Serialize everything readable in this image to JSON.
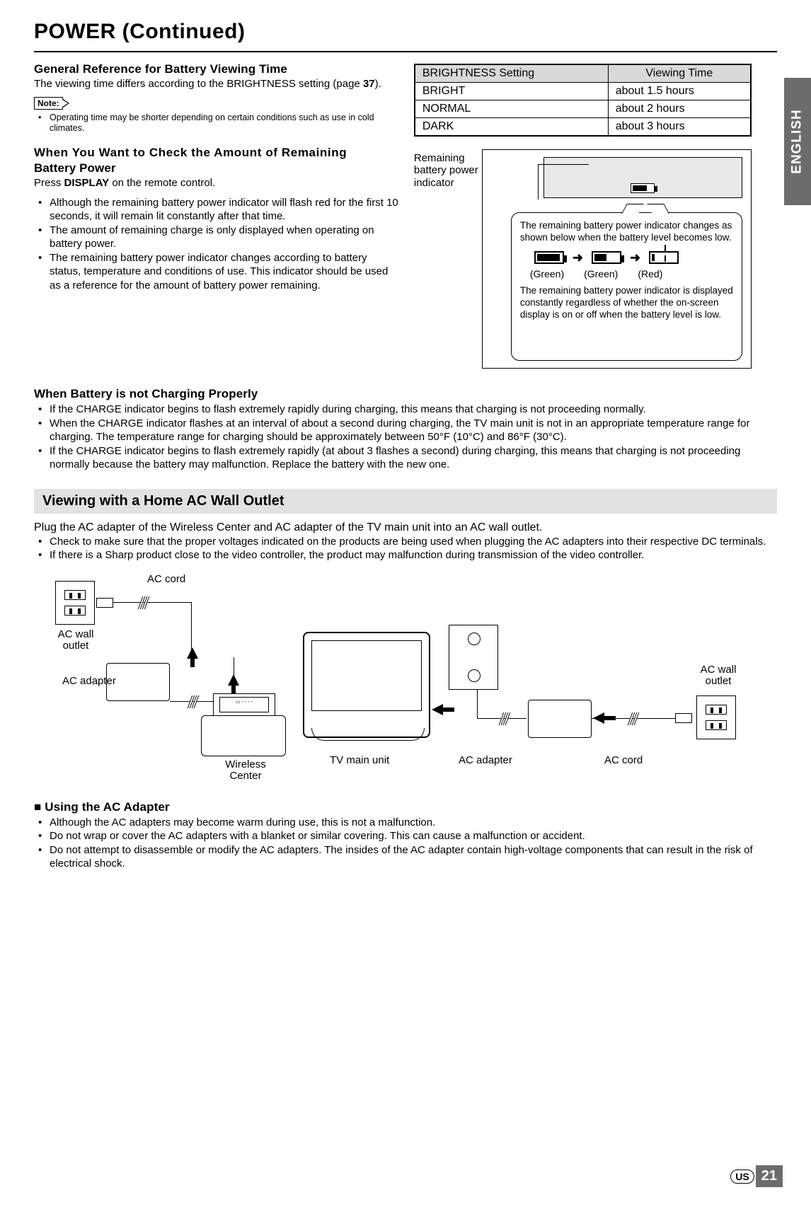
{
  "page_title": "POWER (Continued)",
  "side_tab": "ENGLISH",
  "footer_region": "US",
  "page_number": "21",
  "section1": {
    "heading": "General Reference for Battery Viewing Time",
    "body": "The viewing time differs according to the BRIGHTNESS setting (page ",
    "page_ref": "37",
    "body_end": ").",
    "note_label": "Note:",
    "note_item": "Operating time may be shorter depending on certain conditions such as use in cold climates."
  },
  "brightness_table": {
    "head_setting": "BRIGHTNESS Setting",
    "head_time": "Viewing Time",
    "rows": [
      {
        "setting": "BRIGHT",
        "time": "about 1.5 hours"
      },
      {
        "setting": "NORMAL",
        "time": "about 2 hours"
      },
      {
        "setting": "DARK",
        "time": "about 3 hours"
      }
    ]
  },
  "section2": {
    "heading_line1": "When You Want to Check the Amount of Remaining",
    "heading_line2": "Battery Power",
    "press_pre": "Press ",
    "press_bold": "DISPLAY",
    "press_post": " on the remote control.",
    "bullets": [
      "Although the remaining battery power indicator will flash red for the first 10 seconds, it will remain lit constantly after that time.",
      "The amount of remaining charge is only displayed when operating on battery power.",
      "The remaining battery power indicator changes according to battery status, temperature and conditions of use. This indicator should be used as a reference for the amount of battery power remaining."
    ]
  },
  "diagram_right": {
    "remain_label": "Remaining battery power indicator",
    "callout_p1": "The remaining battery power indicator changes as shown below when the battery level becomes low.",
    "colors": {
      "c1": "(Green)",
      "c2": "(Green)",
      "c3": "(Red)"
    },
    "callout_p2": "The remaining battery power indicator is displayed constantly regardless of whether the on-screen display is on or off when the battery level is low."
  },
  "section3": {
    "heading": "When Battery is not Charging Properly",
    "bullets": [
      "If the CHARGE indicator begins to flash extremely rapidly during charging, this means that charging is not proceeding normally.",
      "When the CHARGE indicator flashes at an interval of about a second during charging, the TV main unit is not in an appropriate temperature range for charging. The temperature range for charging should be approximately between 50°F (10°C) and 86°F (30°C).",
      "If the CHARGE indicator begins to flash extremely rapidly (at about 3 flashes a second) during charging, this means that charging is not proceeding normally because the battery may malfunction. Replace the battery with the new one."
    ]
  },
  "section4": {
    "bar_heading": "Viewing with a Home AC Wall Outlet",
    "intro": "Plug the AC adapter of the Wireless Center and AC adapter of the TV main unit into an AC wall outlet.",
    "bullets": [
      "Check to make sure that the proper voltages indicated on the products are being used when plugging the AC adapters into their respective DC terminals.",
      "If there is a Sharp product close to the video controller, the product may malfunction during transmission of the video controller."
    ]
  },
  "conn_labels": {
    "ac_cord_left": "AC cord",
    "ac_wall_left": "AC wall outlet",
    "ac_adapter_left": "AC adapter",
    "wireless_center": "Wireless Center",
    "tv_main": "TV main unit",
    "ac_adapter_right": "AC adapter",
    "ac_cord_right": "AC cord",
    "ac_wall_right": "AC wall outlet"
  },
  "section5": {
    "heading": "■ Using the AC Adapter",
    "bullets": [
      "Although the AC adapters may become warm during use, this is not a malfunction.",
      "Do not wrap or cover the AC adapters with a blanket or similar covering. This can cause a malfunction or accident.",
      "Do not attempt to disassemble or modify the AC adapters. The insides of the AC adapter contain high-voltage components that can result in the risk of electrical shock."
    ]
  }
}
